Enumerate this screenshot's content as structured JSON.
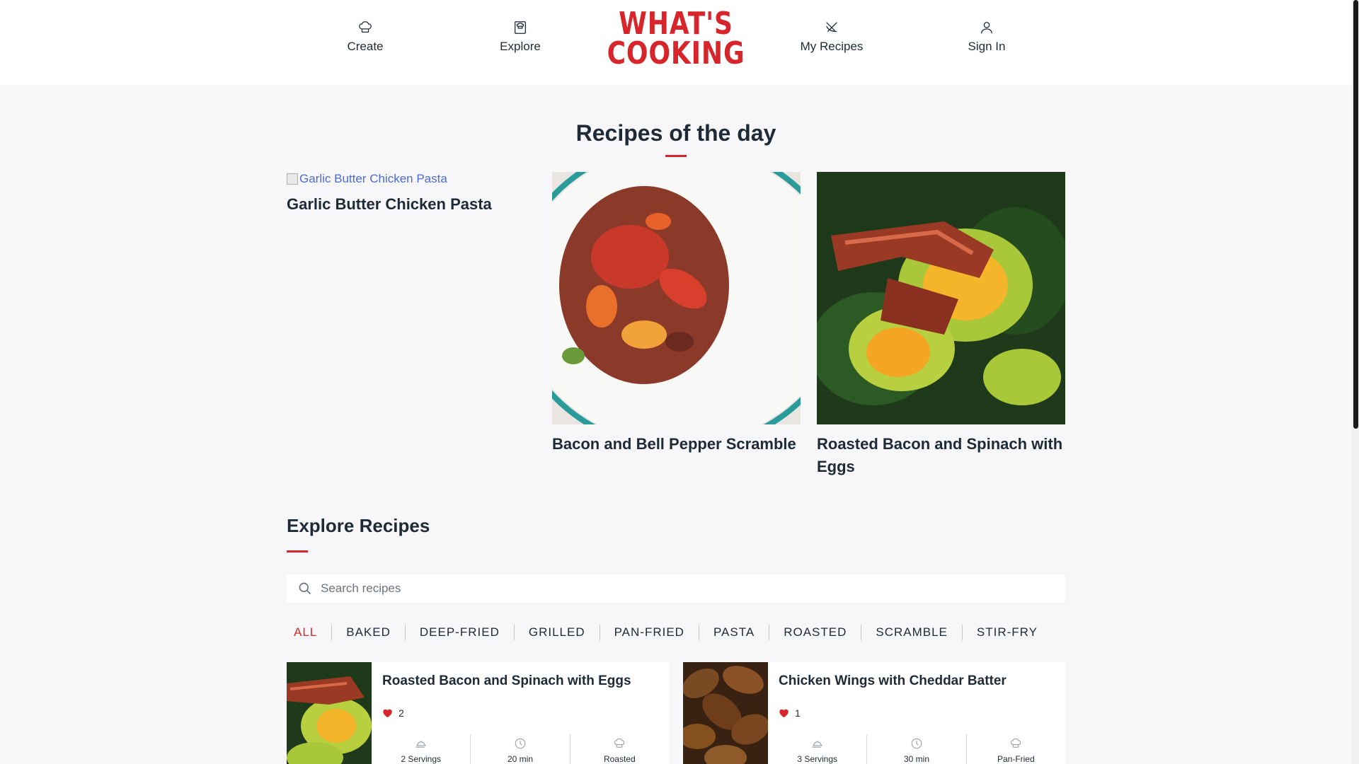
{
  "nav": {
    "create_label": "Create",
    "explore_label": "Explore",
    "my_recipes_label": "My Recipes",
    "sign_in_label": "Sign In",
    "logo_line1": "WHAT'S",
    "logo_line2": "COOKING"
  },
  "colors": {
    "accent": "#d6262b",
    "text": "#1f2a37",
    "background": "#f7f7f9"
  },
  "recipes_of_the_day": {
    "title": "Recipes of the day",
    "items": [
      {
        "title": "Garlic Butter Chicken Pasta",
        "image_alt": "Garlic Butter Chicken Pasta"
      },
      {
        "title": "Bacon and Bell Pepper Scramble"
      },
      {
        "title": "Roasted Bacon and Spinach with Eggs"
      }
    ]
  },
  "explore": {
    "title": "Explore Recipes",
    "search_placeholder": "Search recipes",
    "filters": [
      "ALL",
      "BAKED",
      "DEEP-FRIED",
      "GRILLED",
      "PAN-FRIED",
      "PASTA",
      "ROASTED",
      "SCRAMBLE",
      "STIR-FRY"
    ],
    "active_filter": "ALL",
    "cards": [
      {
        "title": "Roasted Bacon and Spinach with Eggs",
        "likes": "2",
        "servings": "2 Servings",
        "time": "20 min",
        "method": "Roasted"
      },
      {
        "title": "Chicken Wings with Cheddar Batter",
        "likes": "1",
        "servings": "3 Servings",
        "time": "30 min",
        "method": "Pan-Fried"
      }
    ]
  }
}
